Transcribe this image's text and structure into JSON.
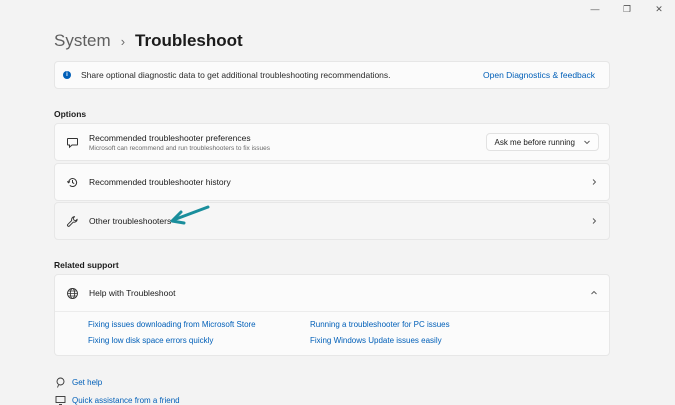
{
  "window": {
    "minimize_glyph": "—",
    "maximize_glyph": "❐",
    "close_glyph": "✕"
  },
  "breadcrumb": {
    "parent": "System",
    "separator": "›",
    "current": "Troubleshoot"
  },
  "info_bar": {
    "text": "Share optional diagnostic data to get additional troubleshooting recommendations.",
    "link": "Open Diagnostics & feedback",
    "icon": "info-icon"
  },
  "options": {
    "title": "Options",
    "items": [
      {
        "icon": "chat-bubble-icon",
        "title": "Recommended troubleshooter preferences",
        "subtitle": "Microsoft can recommend and run troubleshooters to fix issues",
        "dropdown_value": "Ask me before running"
      },
      {
        "icon": "history-icon",
        "title": "Recommended troubleshooter history"
      },
      {
        "icon": "wrench-icon",
        "title": "Other troubleshooters"
      }
    ]
  },
  "related_support": {
    "title": "Related support",
    "help_title": "Help with Troubleshoot",
    "links": [
      "Fixing issues downloading from Microsoft Store",
      "Running a troubleshooter for PC issues",
      "Fixing low disk space errors quickly",
      "Fixing Windows Update issues easily"
    ]
  },
  "footer": {
    "get_help": "Get help",
    "quick_assist": "Quick assistance from a friend"
  },
  "colors": {
    "accent": "#005fb8",
    "annotation_arrow": "#1a8e9c",
    "background": "#f3f3f3",
    "card": "#fbfbfb"
  }
}
